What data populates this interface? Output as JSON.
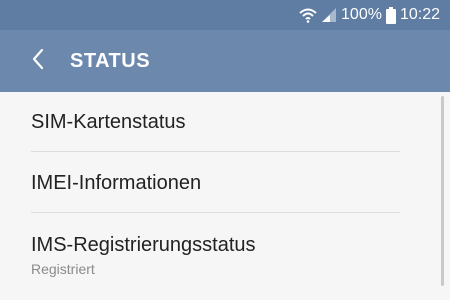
{
  "status_bar": {
    "battery_text": "100%",
    "time": "10:22",
    "icons": [
      "wifi-icon",
      "signal-icon",
      "battery-icon"
    ]
  },
  "app_bar": {
    "title": "STATUS",
    "back_icon": "chevron-left-icon"
  },
  "list": {
    "items": [
      {
        "title": "SIM-Kartenstatus",
        "subtitle": ""
      },
      {
        "title": "IMEI-Informationen",
        "subtitle": ""
      },
      {
        "title": "IMS-Registrierungsstatus",
        "subtitle": "Registriert"
      }
    ]
  },
  "colors": {
    "status_bar": "#5f7ca3",
    "app_bar": "#6c88ad",
    "background": "#f6f6f6",
    "text_primary": "#222222",
    "text_secondary": "#8a8a8a"
  }
}
